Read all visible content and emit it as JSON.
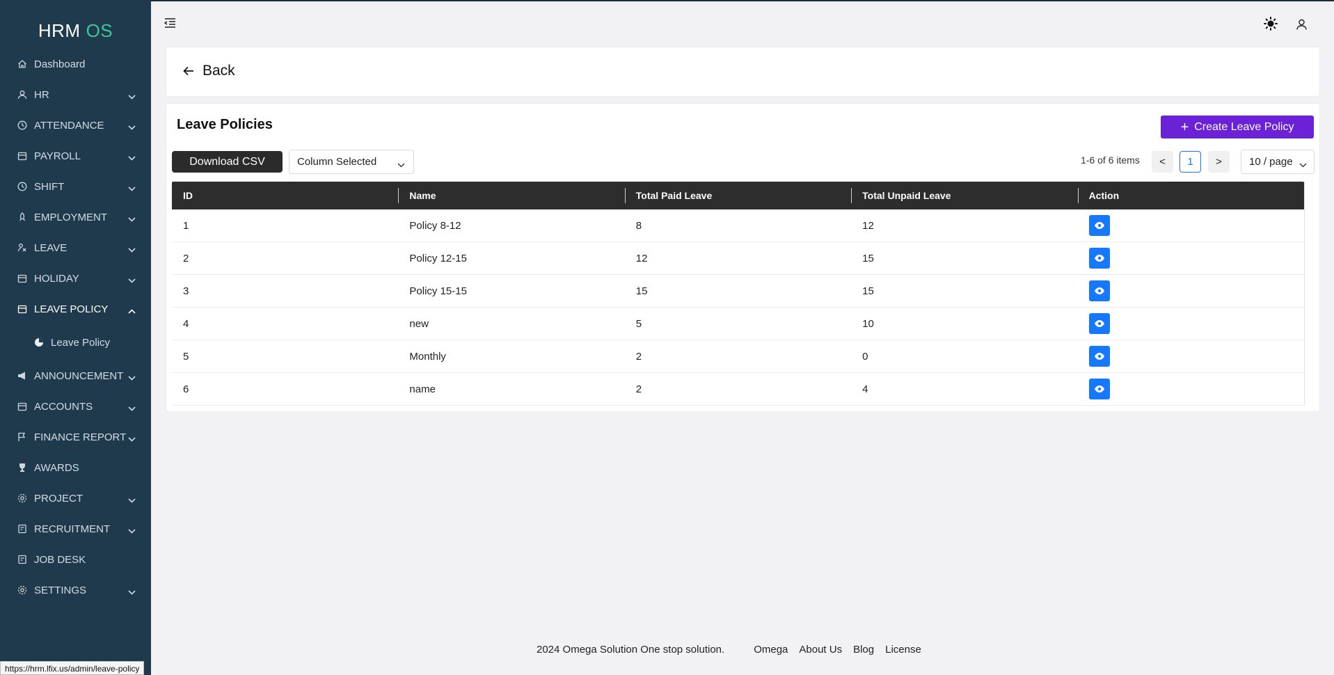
{
  "app": {
    "logo_main": "HRM",
    "logo_accent": "OS",
    "accent_color": "#3ec5a0",
    "sidebar_bg": "#1f3a4d"
  },
  "sidebar": {
    "items": [
      {
        "label": "Dashboard",
        "icon": "home-icon"
      },
      {
        "label": "HR",
        "icon": "user-icon"
      },
      {
        "label": "ATTENDANCE",
        "icon": "clock-icon"
      },
      {
        "label": "PAYROLL",
        "icon": "calendar-icon"
      },
      {
        "label": "SHIFT",
        "icon": "clock-icon"
      },
      {
        "label": "EMPLOYMENT",
        "icon": "rocket-icon"
      },
      {
        "label": "LEAVE",
        "icon": "leave-icon"
      },
      {
        "label": "HOLIDAY",
        "icon": "calendar-icon"
      },
      {
        "label": "LEAVE POLICY",
        "icon": "calendar-icon"
      },
      {
        "label": "Leave Policy",
        "icon": "pie-chart-icon"
      },
      {
        "label": "ANNOUNCEMENT",
        "icon": "megaphone-icon"
      },
      {
        "label": "ACCOUNTS",
        "icon": "calendar-icon"
      },
      {
        "label": "FINANCE REPORT",
        "icon": "flag-icon"
      },
      {
        "label": "AWARDS",
        "icon": "trophy-icon"
      },
      {
        "label": "PROJECT",
        "icon": "gear-icon"
      },
      {
        "label": "RECRUITMENT",
        "icon": "document-icon"
      },
      {
        "label": "JOB DESK",
        "icon": "document-icon"
      },
      {
        "label": "SETTINGS",
        "icon": "gear-icon"
      }
    ]
  },
  "header": {
    "menu_icon": "menu-fold-icon",
    "theme_icon": "sun-icon",
    "user_icon": "user-icon"
  },
  "back": {
    "label": "Back"
  },
  "main": {
    "title": "Leave Policies",
    "create_label": "Create Leave Policy",
    "create_color": "#6b21d6",
    "download_label": "Download CSV",
    "column_select_label": "Column Selected",
    "pagination": {
      "total_text": "1-6 of 6 items",
      "current_page": "1",
      "page_size": "10 / page",
      "prev": "<",
      "next": ">"
    },
    "table": {
      "headers": [
        "ID",
        "Name",
        "Total Paid Leave",
        "Total Unpaid Leave",
        "Action"
      ],
      "rows": [
        {
          "id": "1",
          "name": "Policy 8-12",
          "paid": "8",
          "unpaid": "12"
        },
        {
          "id": "2",
          "name": "Policy 12-15",
          "paid": "12",
          "unpaid": "15"
        },
        {
          "id": "3",
          "name": "Policy 15-15",
          "paid": "15",
          "unpaid": "15"
        },
        {
          "id": "4",
          "name": "new",
          "paid": "5",
          "unpaid": "10"
        },
        {
          "id": "5",
          "name": "Monthly",
          "paid": "2",
          "unpaid": "0"
        },
        {
          "id": "6",
          "name": "name",
          "paid": "2",
          "unpaid": "4"
        }
      ],
      "action_icon": "eye-icon",
      "action_color": "#1677ff"
    }
  },
  "footer": {
    "copyright": "2024 Omega Solution One stop solution.",
    "links": [
      "Omega",
      "About Us",
      "Blog",
      "License"
    ]
  },
  "status_bar": {
    "url": "https://hrm.lfix.us/admin/leave-policy"
  }
}
